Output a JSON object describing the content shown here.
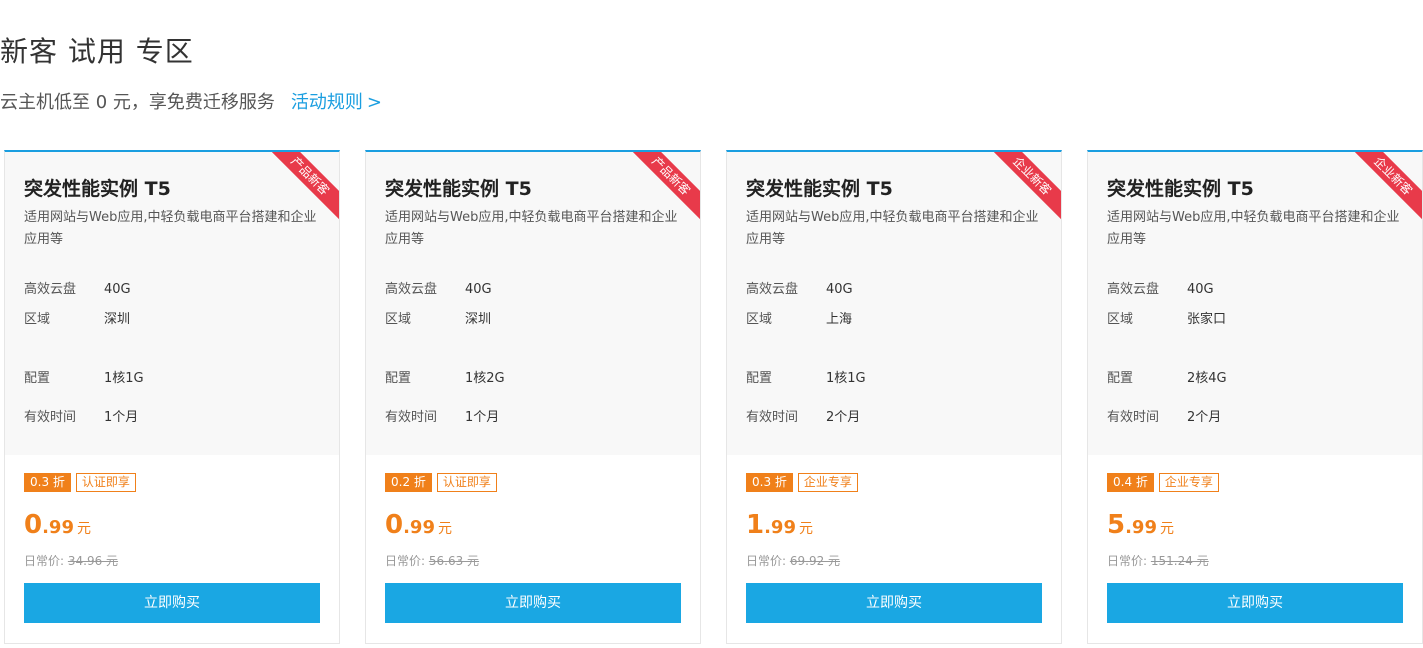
{
  "page": {
    "title": "新客 试用 专区",
    "subtitle": "云主机低至 0 元，享免费迁移服务",
    "rules_link": "活动规则",
    "rules_chevron": ">"
  },
  "colors": {
    "accent": "#1a9ee0",
    "price": "#f0801a",
    "ribbon": "#e83a4a",
    "button": "#1aa7e3"
  },
  "cards": [
    {
      "ribbon": "产品新客",
      "name": "突发性能实例 T5",
      "desc": "适用网站与Web应用,中轻负载电商平台搭建和企业应用等",
      "specs": {
        "disk_label": "高效云盘",
        "disk": "40G",
        "region_label": "区域",
        "region": "深圳",
        "config_label": "配置",
        "config": "1核1G",
        "period_label": "有效时间",
        "period": "1个月"
      },
      "discount": "0.3 折",
      "tag": "认证即享",
      "price_int": "0",
      "price_dec": ".99",
      "price_unit": "元",
      "orig_label": "日常价:",
      "orig_value": "34.96 元",
      "buy": "立即购买"
    },
    {
      "ribbon": "产品新客",
      "name": "突发性能实例 T5",
      "desc": "适用网站与Web应用,中轻负载电商平台搭建和企业应用等",
      "specs": {
        "disk_label": "高效云盘",
        "disk": "40G",
        "region_label": "区域",
        "region": "深圳",
        "config_label": "配置",
        "config": "1核2G",
        "period_label": "有效时间",
        "period": "1个月"
      },
      "discount": "0.2 折",
      "tag": "认证即享",
      "price_int": "0",
      "price_dec": ".99",
      "price_unit": "元",
      "orig_label": "日常价:",
      "orig_value": "56.63 元",
      "buy": "立即购买"
    },
    {
      "ribbon": "企业新客",
      "name": "突发性能实例 T5",
      "desc": "适用网站与Web应用,中轻负载电商平台搭建和企业应用等",
      "specs": {
        "disk_label": "高效云盘",
        "disk": "40G",
        "region_label": "区域",
        "region": "上海",
        "config_label": "配置",
        "config": "1核1G",
        "period_label": "有效时间",
        "period": "2个月"
      },
      "discount": "0.3 折",
      "tag": "企业专享",
      "price_int": "1",
      "price_dec": ".99",
      "price_unit": "元",
      "orig_label": "日常价:",
      "orig_value": "69.92 元",
      "buy": "立即购买"
    },
    {
      "ribbon": "企业新客",
      "name": "突发性能实例 T5",
      "desc": "适用网站与Web应用,中轻负载电商平台搭建和企业应用等",
      "specs": {
        "disk_label": "高效云盘",
        "disk": "40G",
        "region_label": "区域",
        "region": "张家口",
        "config_label": "配置",
        "config": "2核4G",
        "period_label": "有效时间",
        "period": "2个月"
      },
      "discount": "0.4 折",
      "tag": "企业专享",
      "price_int": "5",
      "price_dec": ".99",
      "price_unit": "元",
      "orig_label": "日常价:",
      "orig_value": "151.24 元",
      "buy": "立即购买"
    }
  ]
}
